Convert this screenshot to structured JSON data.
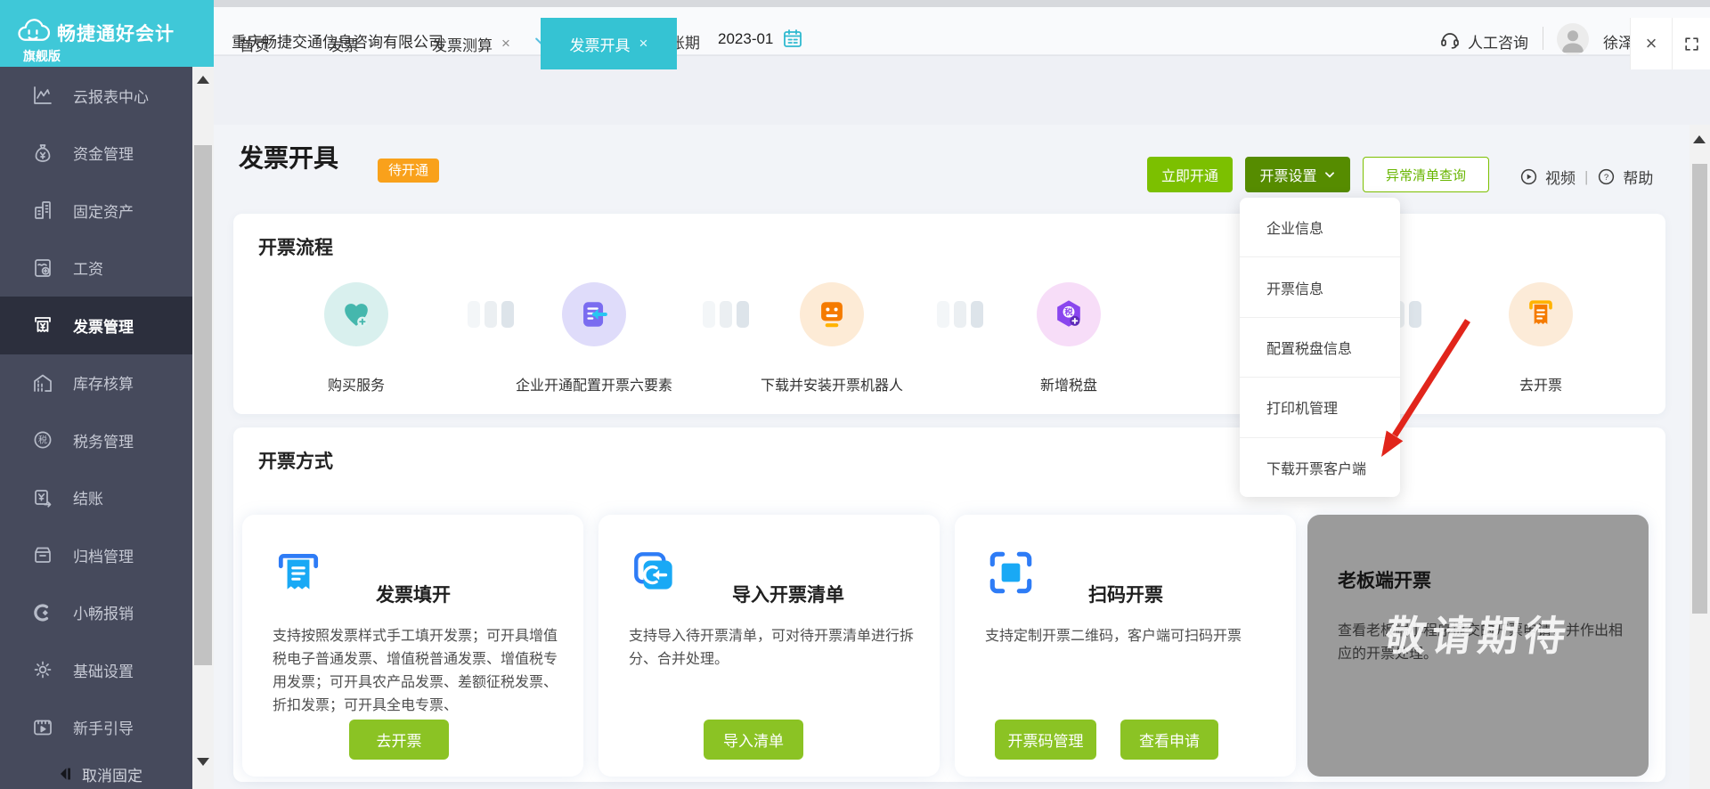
{
  "brand": {
    "name": "畅捷通好会计",
    "edition": "旗舰版"
  },
  "topbar": {
    "company": "重庆畅捷交通信息咨询有限公司",
    "period_label": "账期",
    "period_value": "2023-01",
    "consult_label": "人工咨询",
    "username": "徐泽华"
  },
  "icons": {
    "plus": "+",
    "close": "×",
    "divider": "|"
  },
  "tabs": [
    {
      "label": "首页"
    },
    {
      "label": "发票"
    },
    {
      "label": "发票测算"
    },
    {
      "label": "发票开具"
    }
  ],
  "sidebar": {
    "items": [
      {
        "label": "云报表中心"
      },
      {
        "label": "资金管理"
      },
      {
        "label": "固定资产"
      },
      {
        "label": "工资"
      },
      {
        "label": "发票管理"
      },
      {
        "label": "库存核算"
      },
      {
        "label": "税务管理"
      },
      {
        "label": "结账"
      },
      {
        "label": "归档管理"
      },
      {
        "label": "小畅报销"
      },
      {
        "label": "基础设置"
      },
      {
        "label": "新手引导"
      }
    ],
    "unpin_label": "取消固定"
  },
  "page": {
    "title": "发票开具",
    "status_badge": "待开通",
    "activate_button": "立即开通",
    "settings_button": "开票设置",
    "abnormal_button": "异常清单查询",
    "video_label": "视频",
    "help_label": "帮助"
  },
  "settings_menu": {
    "items": [
      "企业信息",
      "开票信息",
      "配置税盘信息",
      "打印机管理",
      "下载开票客户端"
    ]
  },
  "flow": {
    "heading": "开票流程",
    "steps": [
      {
        "label": "购买服务",
        "icon": "heart-plus-icon"
      },
      {
        "label": "企业开通配置开票六要素",
        "icon": "document-arrow-icon"
      },
      {
        "label": "下载并安装开票机器人",
        "icon": "robot-icon"
      },
      {
        "label": "新增税盘",
        "icon": "tax-disk-plus-icon"
      },
      {
        "label": "去开票",
        "icon": "invoice-printer-icon"
      }
    ]
  },
  "methods": {
    "heading": "开票方式",
    "cards": [
      {
        "title": "发票填开",
        "desc": "支持按照发票样式手工填开发票；可开具增值税电子普通发票、增值税普通发票、增值税专用发票；可开具农产品发票、差额征税发票、折扣发票；可开具全电专票、",
        "buttons": [
          "去开票"
        ]
      },
      {
        "title": "导入开票清单",
        "desc": "支持导入待开票清单，可对待开票清单进行拆分、合并处理。",
        "buttons": [
          "导入清单"
        ]
      },
      {
        "title": "扫码开票",
        "desc": "支持定制开票二维码，客户端可扫码开票",
        "buttons": [
          "开票码管理",
          "查看申请"
        ]
      },
      {
        "title": "老板端开票",
        "desc": "查看老板端小程序提交的开票申请，并作出相应的开票处理。",
        "watermark": "敬请期待",
        "buttons": []
      }
    ]
  },
  "colors": {
    "teal": "#3fc8d8",
    "active_tab": "#35c3d3",
    "green_primary": "#7cc000",
    "green_dark": "#568c00",
    "green_card": "#8bc324",
    "badge_orange": "#f9a11b",
    "sidebar_bg": "#464a5c",
    "sidebar_selected": "#2c2f3d",
    "icon_blue": "#2e7cf6",
    "icon_cyan": "#19a9f5",
    "arrow_red": "#e1251b"
  }
}
